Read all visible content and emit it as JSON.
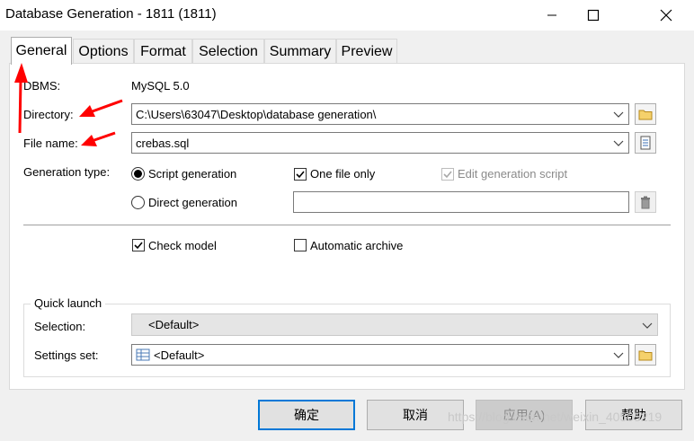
{
  "window": {
    "title": "Database Generation - 1811 (1811)"
  },
  "tabs": [
    {
      "label": "General",
      "active": true
    },
    {
      "label": "Options"
    },
    {
      "label": "Format"
    },
    {
      "label": "Selection"
    },
    {
      "label": "Summary"
    },
    {
      "label": "Preview"
    }
  ],
  "general": {
    "dbms_label": "DBMS:",
    "dbms_value": "MySQL 5.0",
    "directory_label": "Directory:",
    "directory_value": "C:\\Users\\63047\\Desktop\\database generation\\",
    "filename_label": "File name:",
    "filename_value": "crebas.sql",
    "gentype_label": "Generation type:",
    "script_generation": {
      "label": "Script generation",
      "selected": true
    },
    "direct_generation": {
      "label": "Direct generation",
      "selected": false
    },
    "one_file_only": {
      "label": "One file only",
      "checked": true
    },
    "edit_generation_script": {
      "label": "Edit generation script",
      "checked": true,
      "enabled": false
    },
    "direct_generation_value": "",
    "check_model": {
      "label": "Check model",
      "checked": true
    },
    "automatic_archive": {
      "label": "Automatic archive",
      "checked": false
    }
  },
  "quick_launch": {
    "group_label": "Quick launch",
    "selection_label": "Selection:",
    "selection_value": "<Default>",
    "settings_label": "Settings set:",
    "settings_value": "<Default>"
  },
  "buttons": {
    "ok": "确定",
    "cancel": "取消",
    "apply": "应用(A)",
    "help": "帮助"
  },
  "watermark": "https://blog.csdn.net/weixin_40505219",
  "colors": {
    "accent": "#0078d7",
    "annotation_arrow": "#ff0000"
  },
  "icons": [
    "minimize-icon",
    "maximize-icon",
    "close-icon",
    "chevron-down-icon",
    "folder-icon",
    "document-icon",
    "trash-icon",
    "table-icon",
    "checkmark-icon",
    "annotation-arrow"
  ]
}
